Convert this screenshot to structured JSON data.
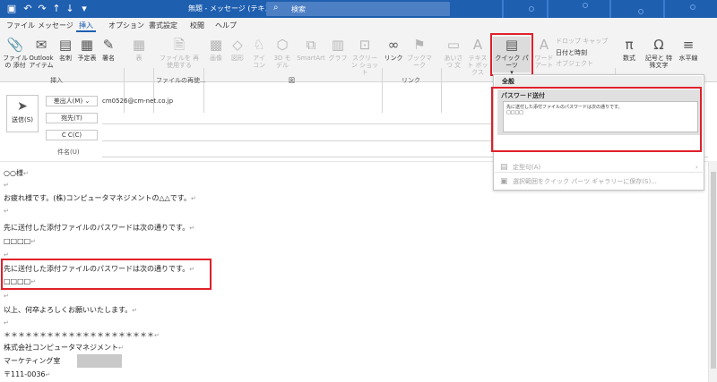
{
  "titlebar": {
    "title": "無題  -  メッセージ (テキスト形式)",
    "search_placeholder": "検索",
    "quick_access": [
      "save-icon",
      "undo-icon",
      "redo-icon",
      "up-icon",
      "down-icon",
      "customize-icon"
    ],
    "bg_color": "#1f5fb0"
  },
  "menubar": {
    "tabs": [
      "ファイル",
      "メッセージ",
      "挿入",
      "オプション",
      "書式設定",
      "校閲",
      "ヘルプ"
    ],
    "active": "挿入"
  },
  "ribbon": {
    "buttons": {
      "attach": "ファイルの 添付",
      "outlook_item": "Outlook アイテム",
      "business_card": "名刺",
      "calendar": "予定表",
      "signature": "署名",
      "table": "表",
      "reuse_file": "ファイルを 再使用する",
      "images": "画像",
      "shapes": "図形",
      "icons": "アイ コン",
      "model3d": "3D モデル",
      "smartart": "SmartArt",
      "chart": "グラフ",
      "screenshot": "スクリーン ショット",
      "link": "リンク",
      "bookmark": "ブックマーク",
      "greeting": "あいさつ 文",
      "textbox": "テキスト ボックス",
      "quick_parts": "クイック パーツ",
      "wordart": "ワード アート",
      "dropcap": "ドロップ キャップ",
      "datetime": "日付と時刻",
      "object": "オブジェクト",
      "equation": "数式",
      "symbol": "記号と 特殊文字",
      "horizontal_line": "水平線"
    },
    "groups": {
      "insert": "挿入",
      "file_reuse": "ファイルの再使...",
      "illustrations": "図",
      "links": "リンク"
    }
  },
  "header": {
    "send": "送信(S)",
    "from_button": "差出人(M)",
    "from_value": "cm0526@cm-net.co.jp",
    "to_button": "宛先(T)",
    "cc_button": "C C(C)",
    "subject_label": "件名(U)"
  },
  "body": {
    "para_mark": "↵",
    "lines": [
      "○○様",
      "",
      "お疲れ様です。(株)コンピュータマネジメントの△△です。",
      "",
      "先に送付した添付ファイルのパスワードは次の通りです。",
      "□□□□",
      "",
      "先に送付した添付ファイルのパスワードは次の通りです。",
      "□□□□",
      "",
      "以上、何卒よろしくお願いいたします。",
      "",
      "＊＊＊＊＊＊＊＊＊＊＊＊＊＊＊＊＊＊＊＊＊",
      "株式会社コンピュータマネジメント",
      "マーケティング室",
      "〒111-0036"
    ]
  },
  "dropdown": {
    "category": "全般",
    "entry_title": "パスワード送付",
    "preview_line1": "先に送付した添付ファイルのパスワードは次の通りです。",
    "preview_line2": "□□□□",
    "menu_autotext": "定型句(A)",
    "menu_save": "選択範囲をクイック パーツ ギャラリーに保存(S)..."
  },
  "colors": {
    "accent": "#1f5fb0",
    "highlight_red": "#e0202a",
    "ribbon_bg": "#f3f3f3"
  }
}
